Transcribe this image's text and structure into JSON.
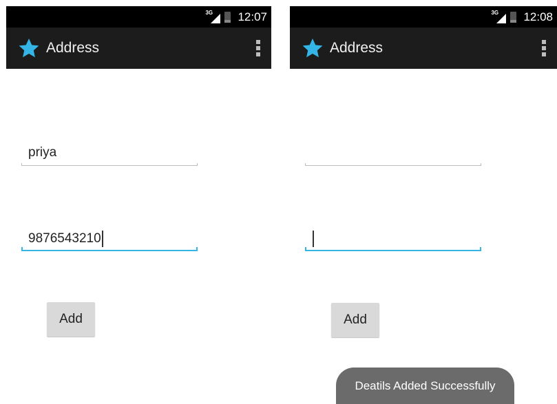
{
  "left": {
    "status": {
      "time": "12:07",
      "network": "3G"
    },
    "app_title": "Address",
    "name_value": "priya",
    "phone_value": "9876543210",
    "add_label": "Add"
  },
  "right": {
    "status": {
      "time": "12:08",
      "network": "3G"
    },
    "app_title": "Address",
    "name_value": "",
    "phone_value": "",
    "add_label": "Add",
    "toast": "Deatils Added Successfully"
  },
  "colors": {
    "accent": "#33b5e5",
    "star": "#33b5e5",
    "actionbar": "#1c1c1c"
  }
}
